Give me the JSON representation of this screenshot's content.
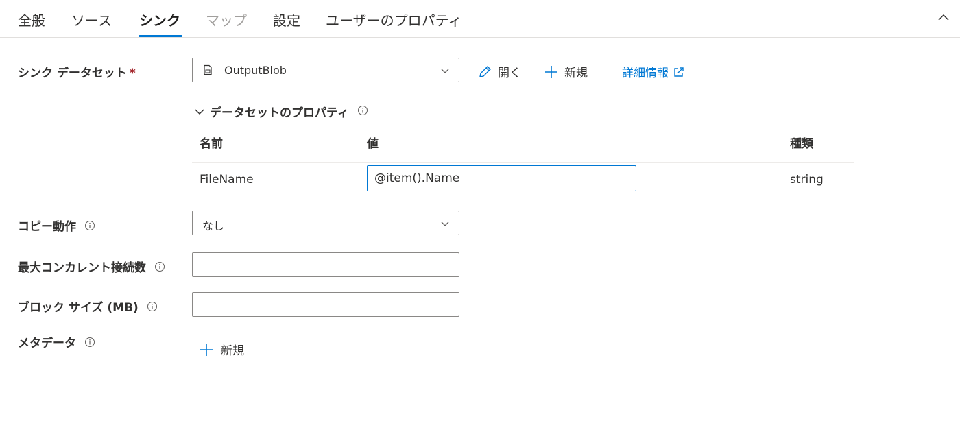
{
  "tabs": [
    {
      "label": "全般",
      "state": "normal"
    },
    {
      "label": "ソース",
      "state": "normal"
    },
    {
      "label": "シンク",
      "state": "active"
    },
    {
      "label": "マップ",
      "state": "disabled"
    },
    {
      "label": "設定",
      "state": "normal"
    },
    {
      "label": "ユーザーのプロパティ",
      "state": "normal"
    }
  ],
  "accent_color": "#0078d4",
  "sink_dataset": {
    "label": "シンク データセット",
    "required_marker": "*",
    "selected": "OutputBlob",
    "open_label": "開く",
    "new_label": "新規",
    "learn_more_label": "詳細情報"
  },
  "dataset_properties": {
    "title": "データセットのプロパティ",
    "columns": [
      "名前",
      "値",
      "種類"
    ],
    "rows": [
      {
        "name": "FileName",
        "value": "@item().Name",
        "type": "string"
      }
    ]
  },
  "copy_behavior": {
    "label": "コピー動作",
    "selected": "なし"
  },
  "max_concurrent_connections": {
    "label": "最大コンカレント接続数",
    "value": ""
  },
  "block_size": {
    "label": "ブロック サイズ (MB)",
    "value": ""
  },
  "metadata": {
    "label": "メタデータ",
    "new_label": "新規"
  }
}
